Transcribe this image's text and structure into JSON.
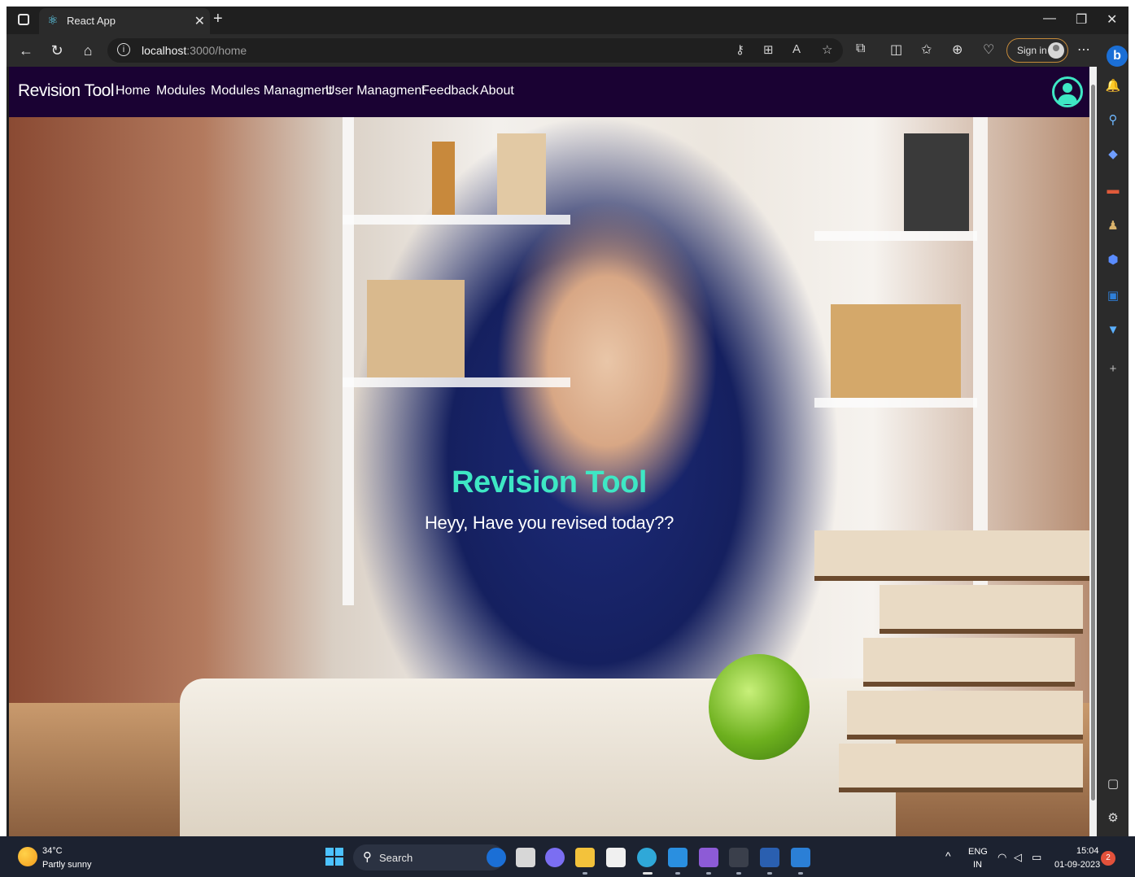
{
  "browser": {
    "tab_title": "React App",
    "url_host": "localhost",
    "url_path": ":3000/home",
    "signin_label": "Sign in"
  },
  "app": {
    "brand": "Revision Tool",
    "nav": [
      "Home",
      "Modules",
      "Modules Managment",
      "User Managment",
      "Feedback",
      "About"
    ],
    "hero_title": "Revision Tool",
    "hero_subtitle": "Heyy, Have you revised today??"
  },
  "taskbar": {
    "temperature": "34°C",
    "weather": "Partly sunny",
    "search_label": "Search",
    "language": "ENG",
    "region": "IN",
    "time": "15:04",
    "date": "01-09-2023",
    "notification_count": "2"
  },
  "colors": {
    "navbar_bg": "#1a0233",
    "accent_teal": "#3ee7c4",
    "browser_dark": "#1f1f1f",
    "taskbar_bg": "#1c2230"
  }
}
